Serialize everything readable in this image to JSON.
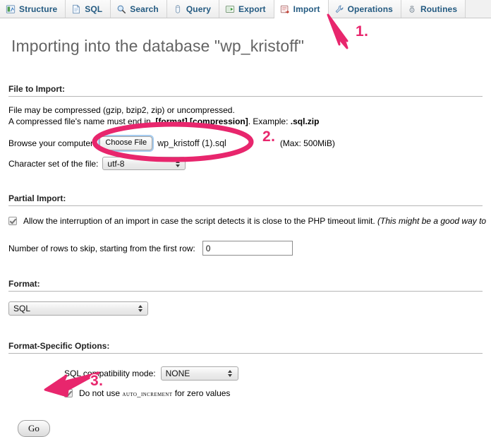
{
  "tabs": [
    {
      "label": "Structure",
      "icon": "structure-icon",
      "active": false
    },
    {
      "label": "SQL",
      "icon": "sql-icon",
      "active": false
    },
    {
      "label": "Search",
      "icon": "search-icon",
      "active": false
    },
    {
      "label": "Query",
      "icon": "query-icon",
      "active": false
    },
    {
      "label": "Export",
      "icon": "export-icon",
      "active": false
    },
    {
      "label": "Import",
      "icon": "import-icon",
      "active": true
    },
    {
      "label": "Operations",
      "icon": "wrench-icon",
      "active": false
    },
    {
      "label": "Routines",
      "icon": "routines-icon",
      "active": false
    }
  ],
  "page": {
    "title": "Importing into the database \"wp_kristoff\""
  },
  "file_to_import": {
    "heading": "File to Import:",
    "desc_line1": "File may be compressed (gzip, bzip2, zip) or uncompressed.",
    "desc_line2_pre": "A compressed file's name must end in ",
    "desc_line2_bold": ".[format].[compression]",
    "desc_line2_mid": ". Example: ",
    "desc_line2_bold2": ".sql.zip",
    "browse_label": "Browse your computer:",
    "choose_file_button": "Choose File",
    "selected_file": "wp_kristoff (1).sql",
    "max_size": "(Max: 500MiB)",
    "charset_label": "Character set of the file:",
    "charset_value": "utf-8"
  },
  "partial_import": {
    "heading": "Partial Import:",
    "allow_interruption_checked": true,
    "allow_interruption_text": "Allow the interruption of an import in case the script detects it is close to the PHP timeout limit.",
    "allow_interruption_italic": "(This might be a good way to",
    "rows_skip_label": "Number of rows to skip, starting from the first row:",
    "rows_skip_value": "0"
  },
  "format": {
    "heading": "Format:",
    "value": "SQL"
  },
  "format_specific_options": {
    "heading": "Format-Specific Options:",
    "compat_label": "SQL compatibility mode:",
    "compat_value": "NONE",
    "auto_increment_checked": true,
    "auto_increment_pre": "Do not use ",
    "auto_increment_code": "AUTO_INCREMENT",
    "auto_increment_post": " for zero values"
  },
  "actions": {
    "go_label": "Go"
  },
  "annotations": {
    "step1": "1.",
    "step2": "2.",
    "step3": "3.",
    "color": "#e8266d"
  }
}
